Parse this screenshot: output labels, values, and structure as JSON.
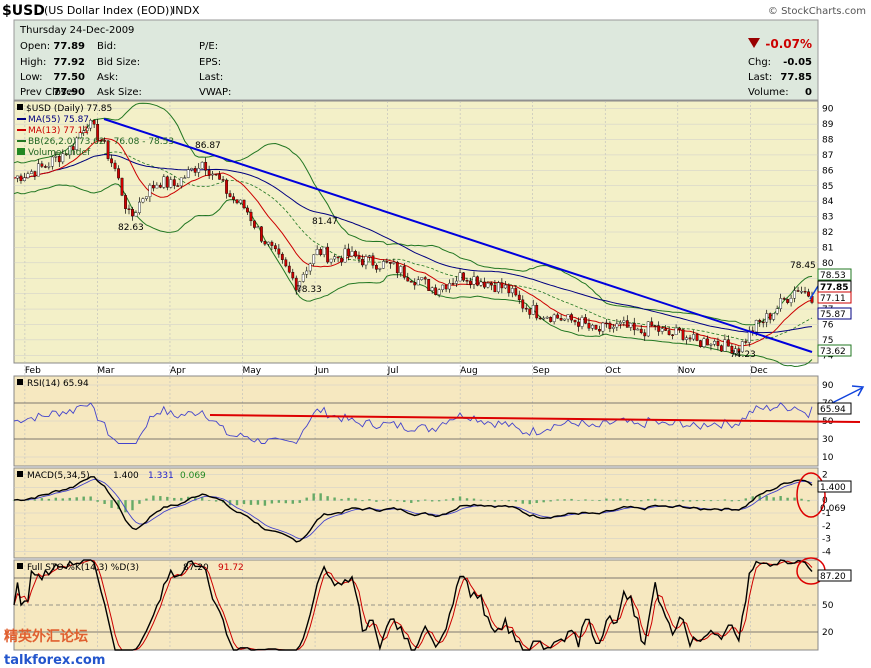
{
  "header": {
    "symbol": "$USD",
    "name": "(US Dollar Index (EOD))",
    "exchange": "INDX",
    "watermark": "© StockCharts.com",
    "date_line": "Thursday 24-Dec-2009",
    "quote": [
      {
        "label": "Open:",
        "value": "77.89"
      },
      {
        "label": "High:",
        "value": "77.92"
      },
      {
        "label": "Low:",
        "value": "77.50"
      },
      {
        "label": "Prev Close:",
        "value": "77.90"
      }
    ],
    "bid": [
      {
        "label": "Bid:",
        "value": ""
      },
      {
        "label": "Bid Size:",
        "value": ""
      },
      {
        "label": "Ask:",
        "value": ""
      },
      {
        "label": "Ask Size:",
        "value": ""
      }
    ],
    "misc": [
      {
        "label": "P/E:",
        "value": ""
      },
      {
        "label": "EPS:",
        "value": ""
      },
      {
        "label": "Last:",
        "value": ""
      },
      {
        "label": "VWAP:",
        "value": ""
      }
    ],
    "change_pct": "-0.07%",
    "right": [
      {
        "label": "Chg:",
        "value": "-0.05"
      },
      {
        "label": "Last:",
        "value": "77.85"
      },
      {
        "label": "Volume:",
        "value": "0"
      }
    ],
    "colors": {
      "down": "#cc0000",
      "bg": "#dde8dd"
    }
  },
  "legend": {
    "price": "$USD (Daily) 77.85",
    "ma55": "MA(55) 75.87",
    "ma13": "MA(13) 77.11",
    "bb": "BB(26,2.0) 73.62 - 76.08 - 78.53",
    "volume": "Volume undef"
  },
  "rsi_legend": "RSI(14) 65.94",
  "macd_legend": {
    "name": "MACD(5,34,5)",
    "v1": "1.400",
    "v2": "1.331",
    "v3": "0.069"
  },
  "sto_legend": {
    "name": "Full STO %K(14,3) %D(3)",
    "v1": "87.20",
    "v2": "91.72"
  },
  "price_labels": {
    "p_high": "90",
    "m86": "86.87",
    "m82": "82.63",
    "m81": "81.47",
    "m78": "78.33",
    "m784": "78.45",
    "m74": "74.23"
  },
  "right_boxes": {
    "bb_up": "78.53",
    "last": "77.85",
    "ma13": "77.11",
    "ma55": "75.87",
    "bb_lo": "73.62",
    "rsi": "65.94",
    "macd": "1.400",
    "macd_h": "0.069",
    "sto": "87.20"
  },
  "months": [
    "Feb",
    "Mar",
    "Apr",
    "May",
    "Jun",
    "Jul",
    "Aug",
    "Sep",
    "Oct",
    "Nov",
    "Dec"
  ],
  "price_ticks": [
    "90",
    "89",
    "88",
    "87",
    "86",
    "85",
    "84",
    "83",
    "82",
    "81",
    "80",
    "79",
    "78",
    "77",
    "76",
    "75",
    "74"
  ],
  "rsi_ticks": [
    "90",
    "70",
    "50",
    "30",
    "10"
  ],
  "macd_ticks": [
    "2",
    "1",
    "0",
    "-1",
    "-2",
    "-3",
    "-4"
  ],
  "sto_ticks": [
    "80",
    "50",
    "20"
  ],
  "watermark2": "talkforex.com",
  "watermark_cn": "精英外汇论坛",
  "chart_data": {
    "type": "line",
    "title": "$USD (US Dollar Index (EOD)) INDX",
    "x_labels": [
      "Feb",
      "Mar",
      "Apr",
      "May",
      "Jun",
      "Jul",
      "Aug",
      "Sep",
      "Oct",
      "Nov",
      "Dec"
    ],
    "x_months": [
      0,
      1,
      2,
      3,
      4,
      5,
      6,
      7,
      8,
      9,
      10,
      11
    ],
    "price_ylim": [
      73.5,
      90.5
    ],
    "price_series": {
      "x": [
        0,
        0.4,
        0.8,
        1.0,
        1.2,
        1.4,
        1.6,
        1.8,
        2.0,
        2.2,
        2.4,
        2.6,
        2.8,
        3.0,
        3.2,
        3.4,
        3.6,
        3.9,
        4.0,
        4.2,
        4.4,
        4.6,
        4.8,
        5.0,
        5.2,
        5.4,
        5.6,
        5.8,
        6.0,
        6.2,
        6.4,
        6.6,
        6.8,
        7.0,
        7.2,
        7.4,
        7.6,
        7.8,
        8.0,
        8.2,
        8.4,
        8.6,
        8.8,
        9.0,
        9.2,
        9.4,
        9.6,
        9.8,
        10.0,
        10.2,
        10.4,
        10.6,
        10.8,
        11.0
      ],
      "close": [
        85.5,
        86.2,
        87.5,
        89.2,
        88.0,
        86.0,
        82.8,
        84.5,
        85.3,
        85.0,
        85.8,
        86.6,
        85.5,
        84.2,
        83.5,
        81.8,
        80.5,
        78.6,
        79.5,
        80.8,
        80.3,
        80.5,
        80.2,
        80.0,
        79.8,
        79.3,
        78.8,
        78.3,
        78.8,
        79.2,
        78.9,
        78.6,
        78.3,
        77.3,
        76.8,
        76.6,
        76.3,
        76.2,
        75.5,
        75.8,
        75.9,
        75.4,
        75.9,
        75.3,
        75.5,
        74.8,
        75.0,
        74.6,
        74.5,
        75.8,
        76.5,
        77.5,
        78.4,
        77.85
      ]
    },
    "trendline": {
      "from": [
        1.05,
        89.5
      ],
      "to": [
        11.0,
        73.9
      ]
    },
    "support_line_rsi": 54,
    "annotations": [
      "86.87",
      "82.63",
      "81.47",
      "78.33",
      "78.45",
      "74.23"
    ],
    "rsi": {
      "ylim": [
        0,
        100
      ],
      "last": 65.94
    },
    "macd": {
      "ylim": [
        -4.5,
        2.5
      ],
      "macd": 1.4,
      "signal": 1.331,
      "hist": 0.069
    },
    "sto": {
      "ylim": [
        0,
        100
      ],
      "k": 87.2,
      "d": 91.72
    }
  }
}
